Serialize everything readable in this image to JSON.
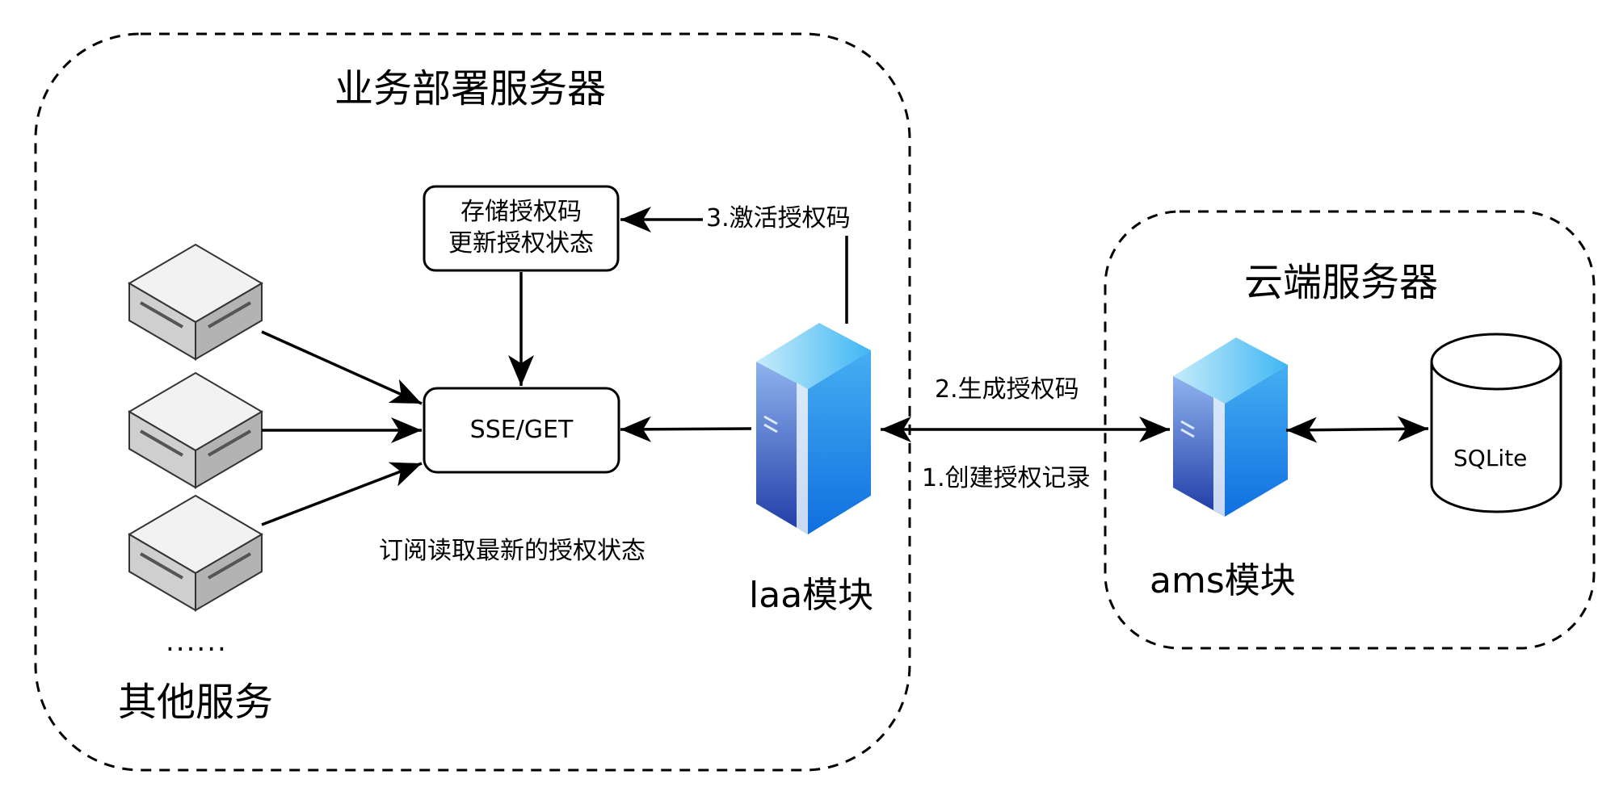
{
  "deploy_server": {
    "title": "业务部署服务器"
  },
  "cloud_server": {
    "title": "云端服务器"
  },
  "store_box": {
    "line1": "存储授权码",
    "line2": "更新授权状态"
  },
  "sse_box": {
    "label": "SSE/GET"
  },
  "subscribe_note": "订阅读取最新的授权状态",
  "other_services": {
    "ellipsis": "......",
    "label": "其他服务"
  },
  "laa_module": {
    "label": "laa模块"
  },
  "ams_module": {
    "label": "ams模块"
  },
  "sqlite": {
    "label": "SQLite"
  },
  "steps": {
    "step1": "1.创建授权记录",
    "step2": "2.生成授权码",
    "step3": "3.激活授权码"
  },
  "colors": {
    "server_top": "#5bc8f5",
    "server_front_top": "#7aa8e8",
    "server_front_bottom": "#1e3fa8",
    "server_side": "#1c8fe6",
    "box_stroke": "#000000"
  },
  "icons": [
    "network-device-icon",
    "server-icon",
    "database-icon"
  ]
}
